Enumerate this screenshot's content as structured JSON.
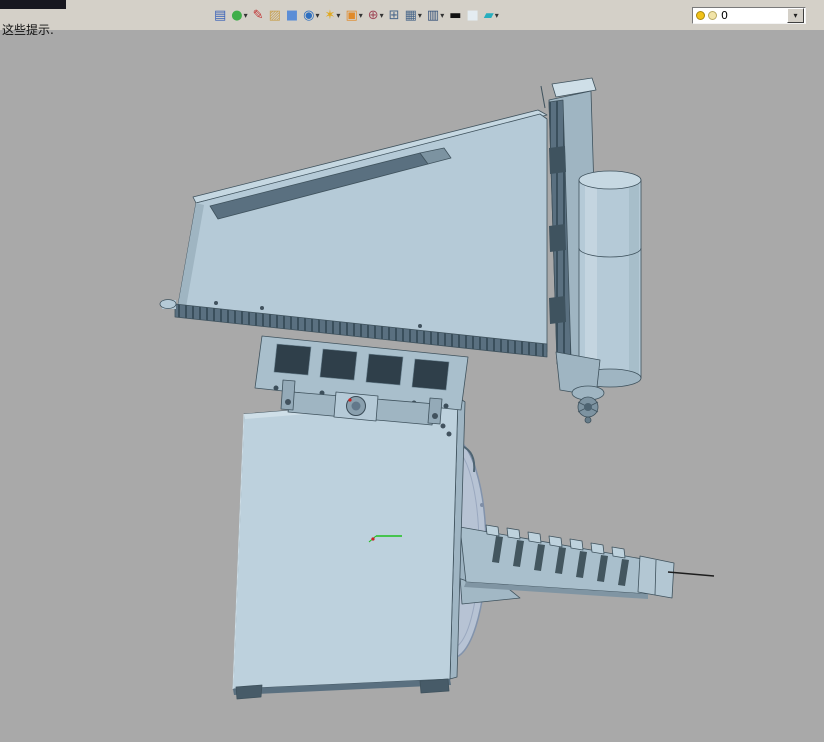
{
  "palette": {
    "viewport_bg": "#a9a9a9",
    "toolbar_bg": "#d4d0c8",
    "corner_dark": "#17171f",
    "combo_bg": "#ffffff",
    "bulb_lit": "#f2c218",
    "bulb_dim": "#f2e4a8",
    "outline": "#3f525d",
    "model_base": "#b5cad7",
    "model_light": "#cfdfe8",
    "model_top": "#c6d8e2",
    "model_mid": "#9fb5c2",
    "model_dark": "#8095a3",
    "model_darker": "#5a7080",
    "window_dark": "#2f3f4a",
    "rail_dark": "#4e6472",
    "carriage_dark": "#3f535f",
    "disc_fill": "#b7c3d4",
    "disc_rim": "#8293ac",
    "accent_green": "#1fbf1f",
    "accent_red": "#cc2222",
    "pointer_black": "#1d1d1d"
  },
  "hint": {
    "text": "这些提示."
  },
  "toolbar": {
    "buttons": [
      {
        "name": "restore-window-icon",
        "glyph": "▤",
        "color": "#3a62b8",
        "dropdown": false
      },
      {
        "name": "material-ball-icon",
        "glyph": "●",
        "color": "#3fae49",
        "dropdown": true
      },
      {
        "name": "appearance-brush-icon",
        "glyph": "✎",
        "color": "#c03030",
        "dropdown": false
      },
      {
        "name": "texture-icon",
        "glyph": "▨",
        "color": "#c8a050",
        "dropdown": false
      },
      {
        "name": "solid-box-icon",
        "glyph": "■",
        "color": "#5b8dd6",
        "dropdown": false
      },
      {
        "name": "shaded-sphere-icon",
        "glyph": "◉",
        "color": "#2e6fc0",
        "dropdown": true
      },
      {
        "name": "render-wheel-icon",
        "glyph": "✶",
        "color": "#e0a81e",
        "dropdown": true
      },
      {
        "name": "scene-icon",
        "glyph": "▣",
        "color": "#e08a2a",
        "dropdown": true
      },
      {
        "name": "locate-target-icon",
        "glyph": "⊕",
        "color": "#a04858",
        "dropdown": true
      },
      {
        "name": "viewport-frame-icon",
        "glyph": "⊞",
        "color": "#49678a",
        "dropdown": false
      },
      {
        "name": "grid-icon",
        "glyph": "▦",
        "color": "#49678a",
        "dropdown": true
      },
      {
        "name": "display-monitor-icon",
        "glyph": "▥",
        "color": "#35527a",
        "dropdown": true
      },
      {
        "name": "line-width-icon",
        "glyph": "▬",
        "color": "#111111",
        "dropdown": false
      },
      {
        "name": "background-swatch-icon",
        "glyph": "■",
        "color": "#e4ecf1",
        "dropdown": false
      },
      {
        "name": "work-plane-icon",
        "glyph": "▰",
        "color": "#27aebe",
        "dropdown": true
      }
    ]
  },
  "layer_combo": {
    "value": "0"
  }
}
